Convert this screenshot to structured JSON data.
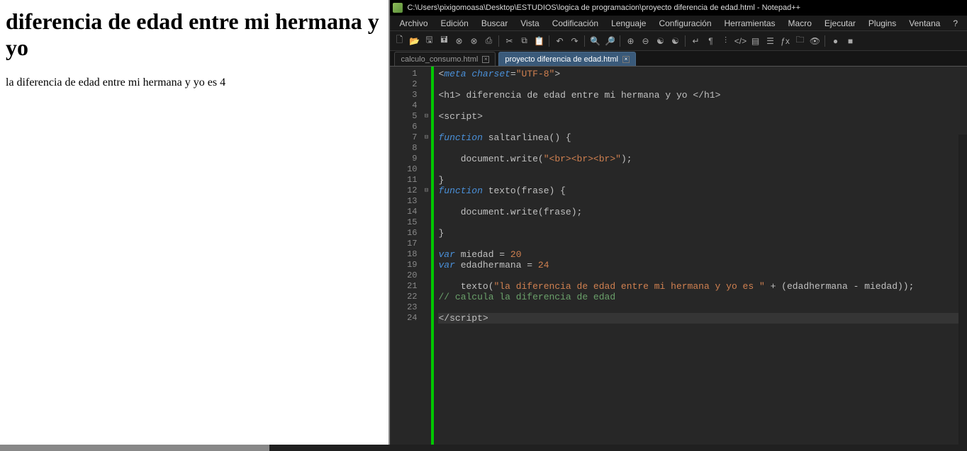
{
  "browser": {
    "heading": "diferencia de edad entre mi hermana y yo",
    "result_prefix": "la diferencia de edad entre mi hermana y yo es ",
    "result_value": "4"
  },
  "editor": {
    "window_title": "C:\\Users\\pixigomoasa\\Desktop\\ESTUDIOS\\logica de programacion\\proyecto diferencia de edad.html - Notepad++",
    "menu": [
      "Archivo",
      "Edición",
      "Buscar",
      "Vista",
      "Codificación",
      "Lenguaje",
      "Configuración",
      "Herramientas",
      "Macro",
      "Ejecutar",
      "Plugins",
      "Ventana",
      "?"
    ],
    "tabs": [
      {
        "label": "calculo_consumo.html",
        "active": false
      },
      {
        "label": "proyecto diferencia de edad.html",
        "active": true
      }
    ],
    "code_tokens": [
      [
        [
          "pun",
          "<"
        ],
        [
          "kw",
          "meta"
        ],
        [
          "meta",
          " "
        ],
        [
          "kw",
          "charset"
        ],
        [
          "pun",
          "="
        ],
        [
          "str",
          "\"UTF-8\""
        ],
        [
          "pun",
          ">"
        ]
      ],
      [],
      [
        [
          "pun",
          "<"
        ],
        [
          "hltag",
          "h1"
        ],
        [
          "pun",
          "> "
        ],
        [
          "meta",
          "diferencia de edad entre mi hermana y yo "
        ],
        [
          "pun",
          "</"
        ],
        [
          "hltag",
          "h1"
        ],
        [
          "pun",
          ">"
        ]
      ],
      [],
      [
        [
          "pun",
          "<"
        ],
        [
          "hltag",
          "script"
        ],
        [
          "pun",
          ">"
        ]
      ],
      [],
      [
        [
          "kw",
          "function"
        ],
        [
          "meta",
          " saltarlinea"
        ],
        [
          "pun",
          "() {"
        ]
      ],
      [],
      [
        [
          "meta",
          "    document.write("
        ],
        [
          "str",
          "\"<br><br><br>\""
        ],
        [
          "meta",
          ");"
        ]
      ],
      [],
      [
        [
          "pun",
          "}"
        ]
      ],
      [
        [
          "kw",
          "function"
        ],
        [
          "meta",
          " texto"
        ],
        [
          "pun",
          "("
        ],
        [
          "meta",
          "frase"
        ],
        [
          "pun",
          ") {"
        ]
      ],
      [],
      [
        [
          "meta",
          "    document.write(frase);"
        ]
      ],
      [],
      [
        [
          "pun",
          "}"
        ]
      ],
      [],
      [
        [
          "kw",
          "var"
        ],
        [
          "meta",
          " miedad = "
        ],
        [
          "num",
          "20"
        ]
      ],
      [
        [
          "kw",
          "var"
        ],
        [
          "meta",
          " edadhermana = "
        ],
        [
          "num",
          "24"
        ]
      ],
      [],
      [
        [
          "meta",
          "    texto("
        ],
        [
          "str",
          "\"la diferencia de edad entre mi hermana y yo es \""
        ],
        [
          "meta",
          " + (edadhermana - miedad));"
        ]
      ],
      [
        [
          "comm",
          "// calcula la diferencia de edad"
        ]
      ],
      [],
      [
        [
          "pun",
          "</"
        ],
        [
          "hltag",
          "script"
        ],
        [
          "pun",
          ">"
        ]
      ]
    ],
    "fold_marks": {
      "5": "⊟",
      "7": "⊟",
      "12": "⊟"
    },
    "current_line": 24,
    "line_count": 24
  }
}
